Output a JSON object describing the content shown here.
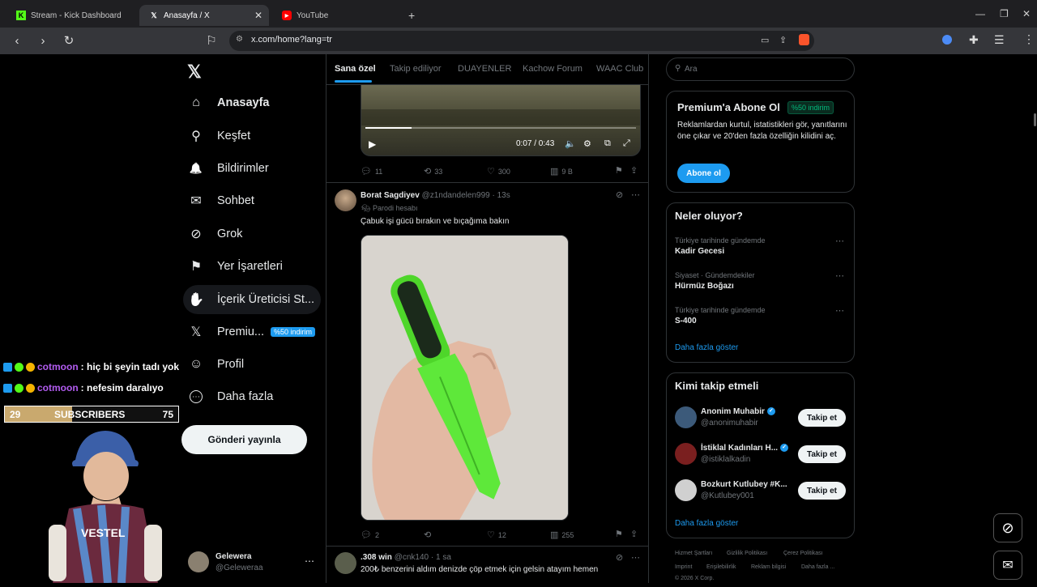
{
  "browser": {
    "tabs": [
      {
        "title": "Stream - Kick Dashboard",
        "active": false
      },
      {
        "title": "Anasayfa / X",
        "active": true
      },
      {
        "title": "YouTube",
        "active": false
      }
    ],
    "url": "x.com/home?lang=tr",
    "new_tab": "+"
  },
  "nav": {
    "items": [
      {
        "label": "Anasayfa",
        "icon": "home-icon",
        "glyph": "⌂"
      },
      {
        "label": "Keşfet",
        "icon": "search-icon",
        "glyph": "⚲"
      },
      {
        "label": "Bildirimler",
        "icon": "bell-icon",
        "glyph": "🔔"
      },
      {
        "label": "Sohbet",
        "icon": "mail-icon",
        "glyph": "✉"
      },
      {
        "label": "Grok",
        "icon": "grok-icon",
        "glyph": "⊘"
      },
      {
        "label": "Yer İşaretleri",
        "icon": "bookmark-icon",
        "glyph": "⚑"
      },
      {
        "label": "İçerik Üreticisi St...",
        "icon": "creator-icon",
        "glyph": "✋"
      },
      {
        "label": "Premiu...",
        "icon": "x-logo-icon",
        "glyph": "𝕏"
      },
      {
        "label": "Profil",
        "icon": "user-icon",
        "glyph": "☺"
      },
      {
        "label": "Daha fazla",
        "icon": "more-icon",
        "glyph": "⋯"
      }
    ],
    "premium_badge": "%50 indirim",
    "post_button": "Gönderi yayınla",
    "account": {
      "name": "Gelewera",
      "handle": "@Geleweraa"
    }
  },
  "feed_tabs": [
    "Sana özel",
    "Takip ediliyor",
    "DUAYENLER",
    "Kachow Forum",
    "WAAC Club"
  ],
  "video": {
    "time": "0:07 / 0:43",
    "progress": 0.17
  },
  "tweet1_actions": {
    "replies": "11",
    "retweets": "33",
    "likes": "300",
    "views": "9 B"
  },
  "tweet2": {
    "name": "Borat Sagdiyev",
    "handle": "@z1ndandelen999",
    "time": "· 13s",
    "label": "Parodi hesabı",
    "text": "Çabuk işi gücü bırakın ve bıçağıma bakın",
    "replies": "2",
    "retweets": "",
    "likes": "12",
    "views": "255"
  },
  "tweet3": {
    "name": ".308 win",
    "handle": "@cnk140",
    "time": "· 1 sa",
    "text": "200₺ benzerini aldım denizde çöp etmek için gelsin atayım hemen"
  },
  "right": {
    "search_placeholder": "Ara",
    "premium": {
      "title": "Premium'a Abone Ol",
      "badge": "%50 indirim",
      "text": "Reklamlardan kurtul, istatistikleri gör, yanıtlarını öne çıkar ve 20'den fazla özelliğin kilidini aç.",
      "button": "Abone ol"
    },
    "trends": {
      "title": "Neler oluyor?",
      "items": [
        {
          "meta": "Türkiye tarihinde gündemde",
          "name": "Kadir Gecesi"
        },
        {
          "meta": "Siyaset · Gündemdekiler",
          "name": "Hürmüz Boğazı"
        },
        {
          "meta": "Türkiye tarihinde gündemde",
          "name": "S-400"
        }
      ],
      "more": "Daha fazla göster"
    },
    "who": {
      "title": "Kimi takip etmeli",
      "items": [
        {
          "name": "Anonim Muhabir",
          "handle": "@anonimuhabir",
          "verified": true,
          "button": "Takip et"
        },
        {
          "name": "İstiklal Kadınları H...",
          "handle": "@istiklalkadin",
          "verified": true,
          "button": "Takip et"
        },
        {
          "name": "Bozkurt Kutlubey #K...",
          "handle": "@Kutlubey001",
          "verified": false,
          "button": "Takip et"
        }
      ],
      "more": "Daha fazla göster"
    },
    "footer": [
      "Hizmet Şartları",
      "Gizlilik Politikası",
      "Çerez Politikası",
      "Imprint",
      "Erişilebilirlik",
      "Reklam bilgisi",
      "Daha fazla ...",
      "© 2026 X Corp."
    ]
  },
  "overlay": {
    "chat": [
      {
        "user": "cotmoon",
        "msg": ": hiç bi şeyin tadı yok"
      },
      {
        "user": "cotmoon",
        "msg": ": nefesim daralıyo"
      }
    ],
    "sub_left": "29",
    "sub_label": "SUBSCRIBERS",
    "sub_right": "75",
    "sub_progress": 0.39
  },
  "colors": {
    "accent": "#1d9bf0",
    "kick_green": "#53fc18",
    "chat_user": "#b25cf0"
  }
}
